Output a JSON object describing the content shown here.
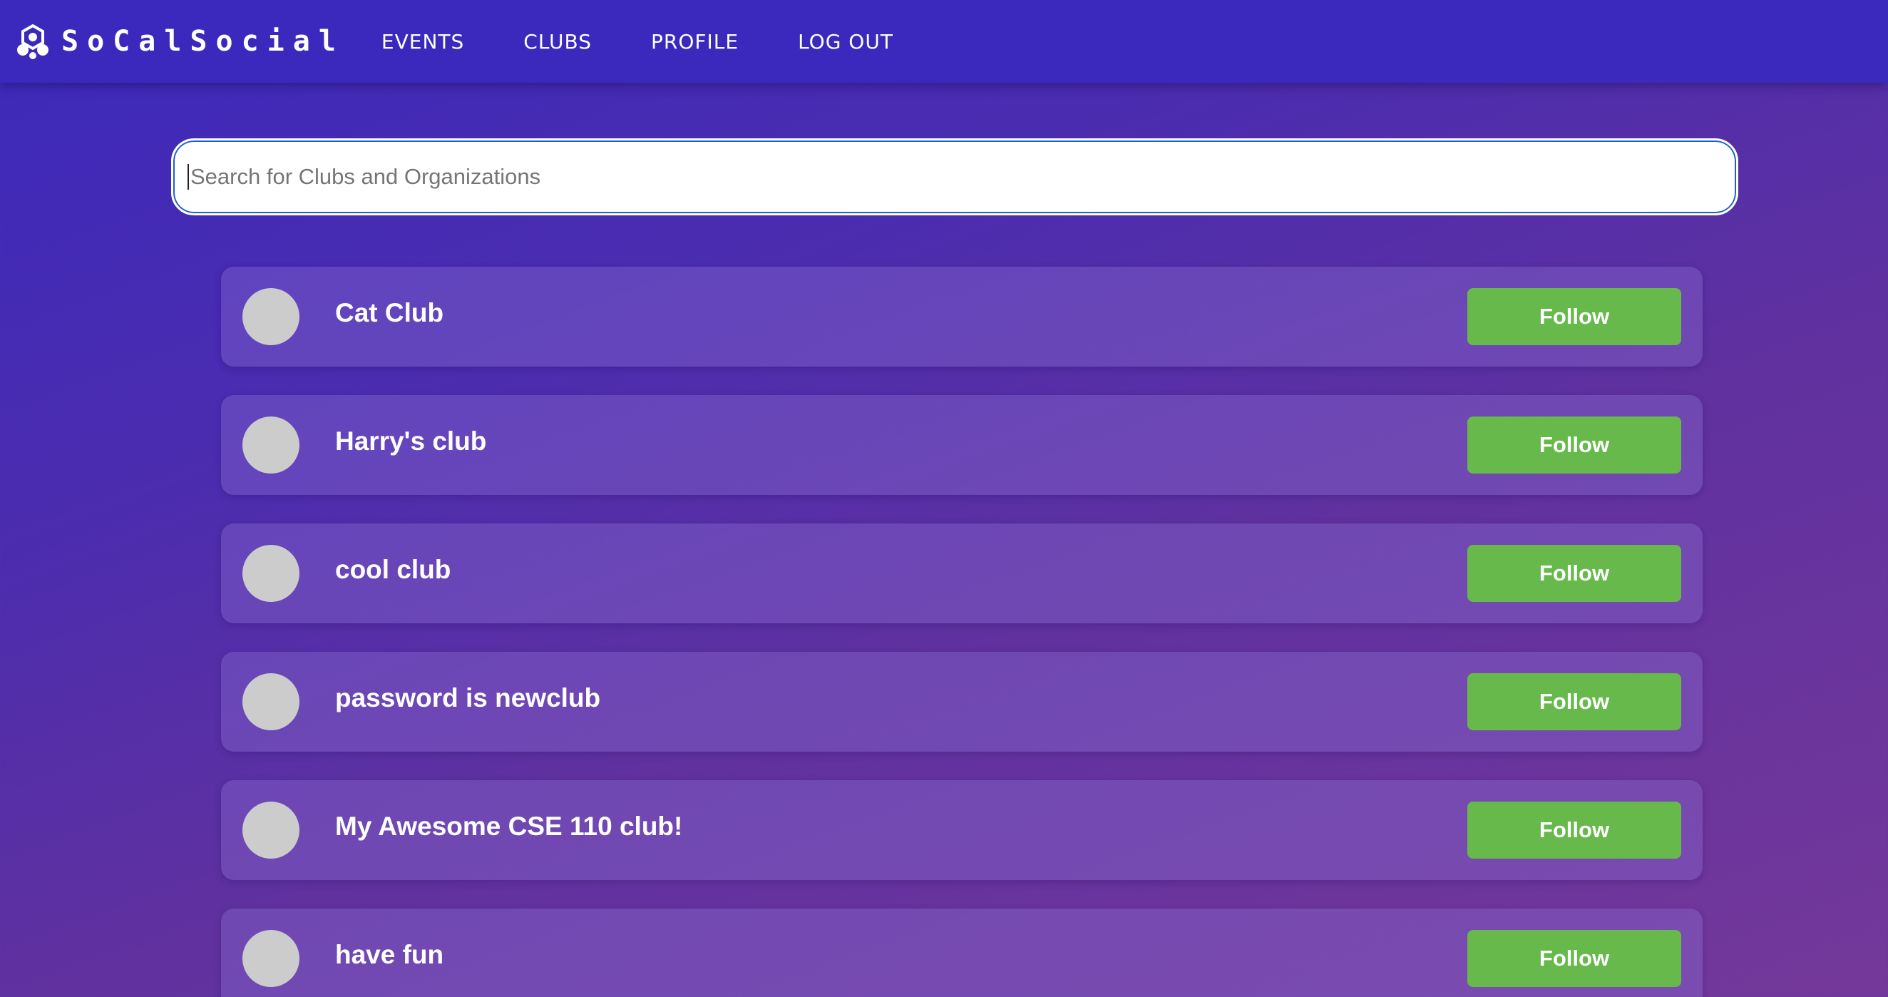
{
  "nav": {
    "brand": "SoCalSocial",
    "brand_icon": "cluster-logo-icon",
    "links": [
      {
        "label": "EVENTS"
      },
      {
        "label": "CLUBS"
      },
      {
        "label": "PROFILE"
      },
      {
        "label": "LOG OUT"
      }
    ]
  },
  "search": {
    "placeholder": "Search for Clubs and Organizations",
    "value": ""
  },
  "clubs": [
    {
      "name": "Cat Club",
      "button_label": "Follow"
    },
    {
      "name": "Harry's club",
      "button_label": "Follow"
    },
    {
      "name": "cool club",
      "button_label": "Follow"
    },
    {
      "name": "password is newclub",
      "button_label": "Follow"
    },
    {
      "name": "My Awesome CSE 110 club!",
      "button_label": "Follow"
    },
    {
      "name": "have fun",
      "button_label": "Follow"
    }
  ],
  "colors": {
    "navbar": "#3a29bc",
    "follow_button": "#66b94a",
    "avatar_placeholder": "#cccccc"
  }
}
